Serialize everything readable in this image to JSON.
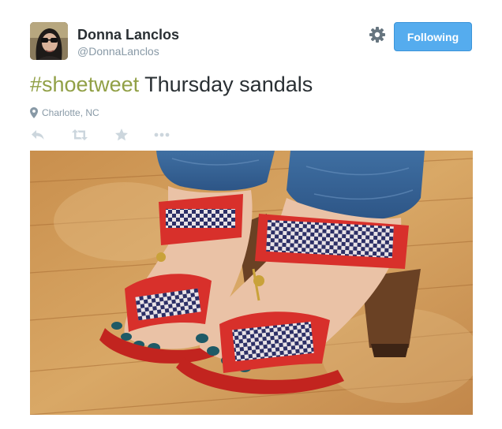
{
  "user": {
    "display_name": "Donna Lanclos",
    "handle": "@DonnaLanclos"
  },
  "follow_button": {
    "label": "Following"
  },
  "tweet": {
    "hashtag": "#shoetweet",
    "text": " Thursday sandals",
    "location": "Charlotte, NC"
  },
  "actions": [
    "reply-icon",
    "retweet-icon",
    "favorite-icon",
    "more-icon"
  ],
  "colors": {
    "follow_button": "#55acee",
    "hashtag": "#91a046",
    "muted": "#8899a6",
    "text": "#292f33",
    "icon": "#ccd6dd"
  }
}
